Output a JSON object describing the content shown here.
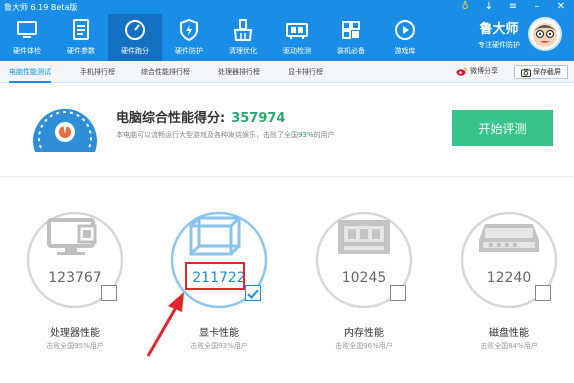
{
  "app": {
    "title": "鲁大师 6.19 Beta版",
    "accent": "#1a8ee6",
    "green": "#2aaa6a"
  },
  "nav": [
    {
      "label": "硬件体检",
      "icon": "monitor-icon"
    },
    {
      "label": "硬件参数",
      "icon": "document-list-icon"
    },
    {
      "label": "硬件跑分",
      "icon": "speedometer-icon"
    },
    {
      "label": "硬件防护",
      "icon": "shield-icon"
    },
    {
      "label": "清理优化",
      "icon": "broom-icon"
    },
    {
      "label": "驱动检测",
      "icon": "driver-chip-icon"
    },
    {
      "label": "装机必备",
      "icon": "app-grid-icon"
    },
    {
      "label": "游戏库",
      "icon": "gamepad-icon"
    }
  ],
  "brand": {
    "name": "鲁大师",
    "slogan": "专注硬件防护"
  },
  "subtabs": [
    "电脑性能测试",
    "手机排行榜",
    "综合性能排行榜",
    "处理器排行榜",
    "显卡排行榜"
  ],
  "share_label": "微博分享",
  "save_label": "保存截屏",
  "score": {
    "title": "电脑综合性能得分:",
    "value": "357974",
    "sub_prefix": "本电脑可以流畅运行大型游戏及各种发烧娱乐，击败了全国",
    "sub_percent": "93%",
    "sub_suffix": "的用户"
  },
  "start_button": "开始评测",
  "cards": [
    {
      "name": "处理器性能",
      "value": "123767",
      "desc": "击败全国95%用户",
      "checked": false,
      "icon": "cpu-monitor-icon"
    },
    {
      "name": "显卡性能",
      "value": "211722",
      "desc": "击败全国93%用户",
      "checked": true,
      "icon": "gpu-cube-icon"
    },
    {
      "name": "内存性能",
      "value": "10245",
      "desc": "击败全国96%用户",
      "checked": false,
      "icon": "memory-chip-icon"
    },
    {
      "name": "磁盘性能",
      "value": "12240",
      "desc": "击败全国84%用户",
      "checked": false,
      "icon": "harddisk-icon"
    }
  ]
}
